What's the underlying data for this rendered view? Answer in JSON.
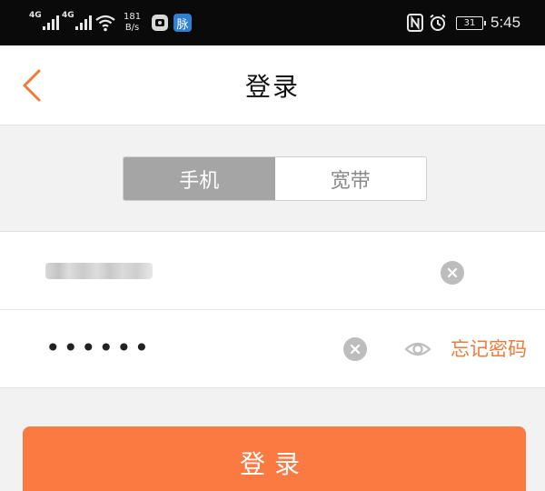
{
  "status_bar": {
    "signal1": "4G",
    "signal2": "4G",
    "net_speed_value": "181",
    "net_speed_unit": "B/s",
    "app_badge_text": "脉",
    "battery": "31",
    "time": "5:45",
    "icons": [
      "signal-icon",
      "wifi-icon",
      "app-icon",
      "nfc-icon",
      "alarm-icon",
      "battery-icon"
    ]
  },
  "header": {
    "title": "登录",
    "back_icon": "chevron-left-icon"
  },
  "tabs": [
    {
      "label": "手机",
      "active": true
    },
    {
      "label": "宽带",
      "active": false
    }
  ],
  "form": {
    "phone_masked": true,
    "password_value": "••••••",
    "forgot_label": "忘记密码",
    "icons": [
      "clear-icon",
      "eye-icon"
    ]
  },
  "login_button": {
    "label": "登录"
  },
  "colors": {
    "accent": "#fb7a41",
    "link": "#f07a3a",
    "tab_active_bg": "#a5a5a5",
    "background": "#f2f2f2"
  }
}
